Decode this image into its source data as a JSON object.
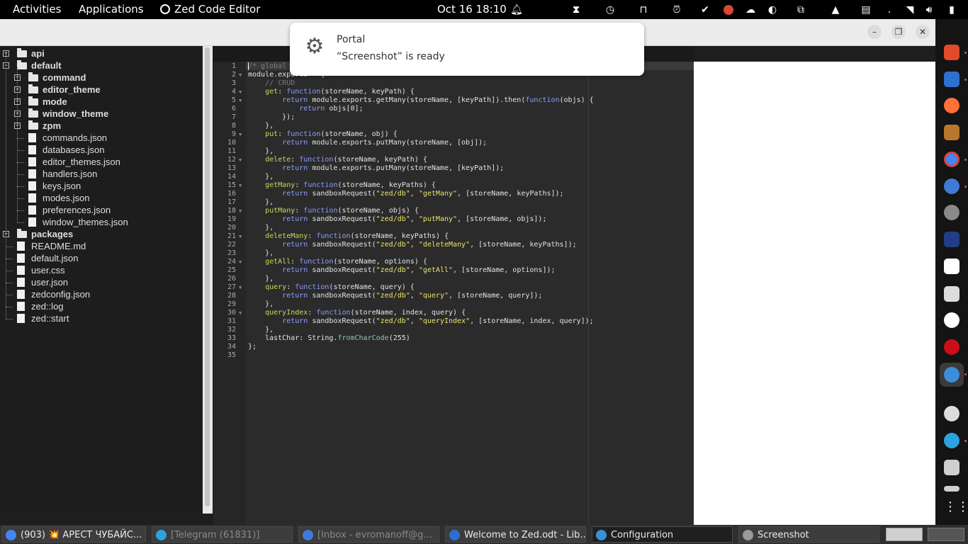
{
  "topbar": {
    "activities": "Activities",
    "applications": "Applications",
    "app_name": "Zed Code Editor",
    "clock": "Oct 16  18:10"
  },
  "notification": {
    "title": "Portal",
    "body": "“Screenshot” is ready"
  },
  "tree": {
    "nodes": [
      {
        "label": "api",
        "type": "dir",
        "expanded": false
      },
      {
        "label": "default",
        "type": "dir",
        "expanded": true
      },
      {
        "label": "command",
        "type": "dir",
        "expanded": false
      },
      {
        "label": "editor_theme",
        "type": "dir",
        "expanded": false
      },
      {
        "label": "mode",
        "type": "dir",
        "expanded": false
      },
      {
        "label": "window_theme",
        "type": "dir",
        "expanded": false
      },
      {
        "label": "zpm",
        "type": "dir",
        "expanded": false
      },
      {
        "label": "commands.json",
        "type": "file"
      },
      {
        "label": "databases.json",
        "type": "file"
      },
      {
        "label": "editor_themes.json",
        "type": "file"
      },
      {
        "label": "handlers.json",
        "type": "file"
      },
      {
        "label": "keys.json",
        "type": "file"
      },
      {
        "label": "modes.json",
        "type": "file"
      },
      {
        "label": "preferences.json",
        "type": "file"
      },
      {
        "label": "window_themes.json",
        "type": "file"
      },
      {
        "label": "packages",
        "type": "dir",
        "expanded": false
      },
      {
        "label": "README.md",
        "type": "file"
      },
      {
        "label": "default.json",
        "type": "file"
      },
      {
        "label": "user.css",
        "type": "file"
      },
      {
        "label": "user.json",
        "type": "file"
      },
      {
        "label": "zedconfig.json",
        "type": "file"
      },
      {
        "label": "zed::log",
        "type": "file"
      },
      {
        "label": "zed::start",
        "type": "file"
      }
    ]
  },
  "editor": {
    "lines": [
      [
        [
          "cmt",
          "/* global"
        ]
      ],
      [
        [
          "",
          "module.exports = {"
        ]
      ],
      [
        [
          "",
          "    "
        ],
        [
          "cmt",
          "// CRUD"
        ]
      ],
      [
        [
          "",
          "    "
        ],
        [
          "key",
          "get"
        ],
        [
          "",
          ": "
        ],
        [
          "kw",
          "function"
        ],
        [
          "",
          "(storeName, keyPath) {"
        ]
      ],
      [
        [
          "",
          "        "
        ],
        [
          "kw",
          "return"
        ],
        [
          "",
          " module.exports.getMany(storeName, [keyPath]).then("
        ],
        [
          "kw",
          "function"
        ],
        [
          "",
          "(objs) {"
        ]
      ],
      [
        [
          "",
          "            "
        ],
        [
          "kw",
          "return"
        ],
        [
          "",
          " objs[0];"
        ]
      ],
      [
        [
          "",
          "        });"
        ]
      ],
      [
        [
          "",
          "    },"
        ]
      ],
      [
        [
          "",
          "    "
        ],
        [
          "key",
          "put"
        ],
        [
          "",
          ": "
        ],
        [
          "kw",
          "function"
        ],
        [
          "",
          "(storeName, obj) {"
        ]
      ],
      [
        [
          "",
          "        "
        ],
        [
          "kw",
          "return"
        ],
        [
          "",
          " module.exports.putMany(storeName, [obj]);"
        ]
      ],
      [
        [
          "",
          "    },"
        ]
      ],
      [
        [
          "",
          "    "
        ],
        [
          "key",
          "delete"
        ],
        [
          "",
          ": "
        ],
        [
          "kw",
          "function"
        ],
        [
          "",
          "(storeName, keyPath) {"
        ]
      ],
      [
        [
          "",
          "        "
        ],
        [
          "kw",
          "return"
        ],
        [
          "",
          " module.exports.putMany(storeName, [keyPath]);"
        ]
      ],
      [
        [
          "",
          "    },"
        ]
      ],
      [
        [
          "",
          "    "
        ],
        [
          "key",
          "getMany"
        ],
        [
          "",
          ": "
        ],
        [
          "kw",
          "function"
        ],
        [
          "",
          "(storeName, keyPaths) {"
        ]
      ],
      [
        [
          "",
          "        "
        ],
        [
          "kw",
          "return"
        ],
        [
          "",
          " sandboxRequest("
        ],
        [
          "str",
          "\"zed/db\""
        ],
        [
          "",
          ", "
        ],
        [
          "str",
          "\"getMany\""
        ],
        [
          "",
          ", [storeName, keyPaths]);"
        ]
      ],
      [
        [
          "",
          "    },"
        ]
      ],
      [
        [
          "",
          "    "
        ],
        [
          "key",
          "putMany"
        ],
        [
          "",
          ": "
        ],
        [
          "kw",
          "function"
        ],
        [
          "",
          "(storeName, objs) {"
        ]
      ],
      [
        [
          "",
          "        "
        ],
        [
          "kw",
          "return"
        ],
        [
          "",
          " sandboxRequest("
        ],
        [
          "str",
          "\"zed/db\""
        ],
        [
          "",
          ", "
        ],
        [
          "str",
          "\"putMany\""
        ],
        [
          "",
          ", [storeName, objs]);"
        ]
      ],
      [
        [
          "",
          "    },"
        ]
      ],
      [
        [
          "",
          "    "
        ],
        [
          "key",
          "deleteMany"
        ],
        [
          "",
          ": "
        ],
        [
          "kw",
          "function"
        ],
        [
          "",
          "(storeName, keyPaths) {"
        ]
      ],
      [
        [
          "",
          "        "
        ],
        [
          "kw",
          "return"
        ],
        [
          "",
          " sandboxRequest("
        ],
        [
          "str",
          "\"zed/db\""
        ],
        [
          "",
          ", "
        ],
        [
          "str",
          "\"deleteMany\""
        ],
        [
          "",
          ", [storeName, keyPaths]);"
        ]
      ],
      [
        [
          "",
          "    },"
        ]
      ],
      [
        [
          "",
          "    "
        ],
        [
          "key",
          "getAll"
        ],
        [
          "",
          ": "
        ],
        [
          "kw",
          "function"
        ],
        [
          "",
          "(storeName, options) {"
        ]
      ],
      [
        [
          "",
          "        "
        ],
        [
          "kw",
          "return"
        ],
        [
          "",
          " sandboxRequest("
        ],
        [
          "str",
          "\"zed/db\""
        ],
        [
          "",
          ", "
        ],
        [
          "str",
          "\"getAll\""
        ],
        [
          "",
          ", [storeName, options]);"
        ]
      ],
      [
        [
          "",
          "    },"
        ]
      ],
      [
        [
          "",
          "    "
        ],
        [
          "key",
          "query"
        ],
        [
          "",
          ": "
        ],
        [
          "kw",
          "function"
        ],
        [
          "",
          "(storeName, query) {"
        ]
      ],
      [
        [
          "",
          "        "
        ],
        [
          "kw",
          "return"
        ],
        [
          "",
          " sandboxRequest("
        ],
        [
          "str",
          "\"zed/db\""
        ],
        [
          "",
          ", "
        ],
        [
          "str",
          "\"query\""
        ],
        [
          "",
          ", [storeName, query]);"
        ]
      ],
      [
        [
          "",
          "    },"
        ]
      ],
      [
        [
          "",
          "    "
        ],
        [
          "key",
          "queryIndex"
        ],
        [
          "",
          ": "
        ],
        [
          "kw",
          "function"
        ],
        [
          "",
          "(storeName, index, query) {"
        ]
      ],
      [
        [
          "",
          "        "
        ],
        [
          "kw",
          "return"
        ],
        [
          "",
          " sandboxRequest("
        ],
        [
          "str",
          "\"zed/db\""
        ],
        [
          "",
          ", "
        ],
        [
          "str",
          "\"queryIndex\""
        ],
        [
          "",
          ", [storeName, index, query]);"
        ]
      ],
      [
        [
          "",
          "    },"
        ]
      ],
      [
        [
          "",
          "    lastChar: String."
        ],
        [
          "fn",
          "fromCharCode"
        ],
        [
          "",
          "(255)"
        ]
      ],
      [
        [
          "",
          "};"
        ]
      ],
      [
        [
          "",
          ""
        ]
      ]
    ],
    "fold_lines": [
      2,
      4,
      5,
      9,
      12,
      15,
      18,
      21,
      24,
      27,
      30
    ]
  },
  "taskbar": {
    "tasks": [
      {
        "label": "(903) 💥 АРЕСТ ЧУБАЙС...",
        "icon": "chrome-icon",
        "color": "#4285f4",
        "state": "normal"
      },
      {
        "label": "[Telegram (61831)]",
        "icon": "telegram-icon",
        "color": "#2aa3df",
        "state": "dim"
      },
      {
        "label": "[Inbox - evromanoff@g...",
        "icon": "thunderbird-icon",
        "color": "#3e7bd6",
        "state": "dim"
      },
      {
        "label": "Welcome to Zed.odt - Lib...",
        "icon": "writer-icon",
        "color": "#2a6fd6",
        "state": "normal"
      },
      {
        "label": "Configuration",
        "icon": "zed-icon",
        "color": "#3a8fd8",
        "state": "active"
      },
      {
        "label": "Screenshot",
        "icon": "screenshot-icon",
        "color": "#9a9a9a",
        "state": "normal"
      }
    ]
  },
  "colors": {
    "accent": "#e95420",
    "keyword": "#8e9eff",
    "property": "#c7d95a",
    "string": "#e8e36b",
    "comment": "#7b7b7b"
  }
}
